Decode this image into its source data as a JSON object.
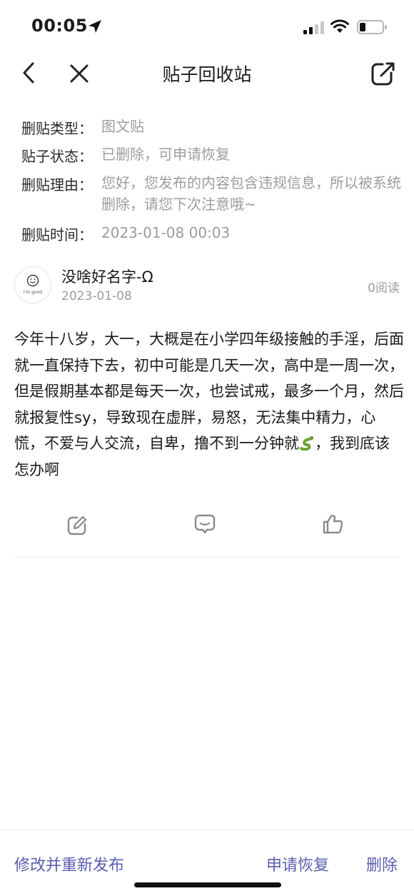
{
  "status_bar": {
    "time": "00:05",
    "icons": [
      "location-arrow-icon",
      "signal-icon",
      "wifi-icon",
      "battery-icon"
    ]
  },
  "nav": {
    "title": "贴子回收站",
    "icons": [
      "back-chevron-icon",
      "close-icon",
      "share-icon"
    ]
  },
  "info": {
    "type_label": "删贴类型：",
    "type_value": "图文贴",
    "status_label": "贴子状态：",
    "status_value": "已删除，可申请恢复",
    "reason_label": "删贴理由：",
    "reason_value": "您好，您发布的内容包含违规信息，所以被系统删除，请您下次注意哦~",
    "time_label": "删贴时间：",
    "time_value": "2023-01-08 00:03"
  },
  "post": {
    "avatar_caption": "I'm good",
    "author": "没啥好名字-Ω",
    "date": "2023-01-08",
    "read_count": "0阅读",
    "body_text": "今年十八岁，大一，大概是在小学四年级接触的手淫，后面就一直保持下去，初中可能是几天一次，高中是一周一次，但是假期基本都是每天一次，也尝试戒，最多一个月，然后就报复性sy，导致现在虚胖，易怒，无法集中精力，心慌，不爱与人交流，自卑，撸不到一分钟就",
    "body_emoji": "snake-emoji",
    "body_tail": "，我到底该怎办啊",
    "actions": [
      "edit-icon",
      "comment-icon",
      "like-icon"
    ]
  },
  "bottom_bar": {
    "edit_repost": "修改并重新发布",
    "restore": "申请恢复",
    "delete": "删除"
  },
  "colors": {
    "accent": "#5a5fb0",
    "muted_text": "#9c9c9c",
    "icon_gray": "#8a8a8a"
  }
}
